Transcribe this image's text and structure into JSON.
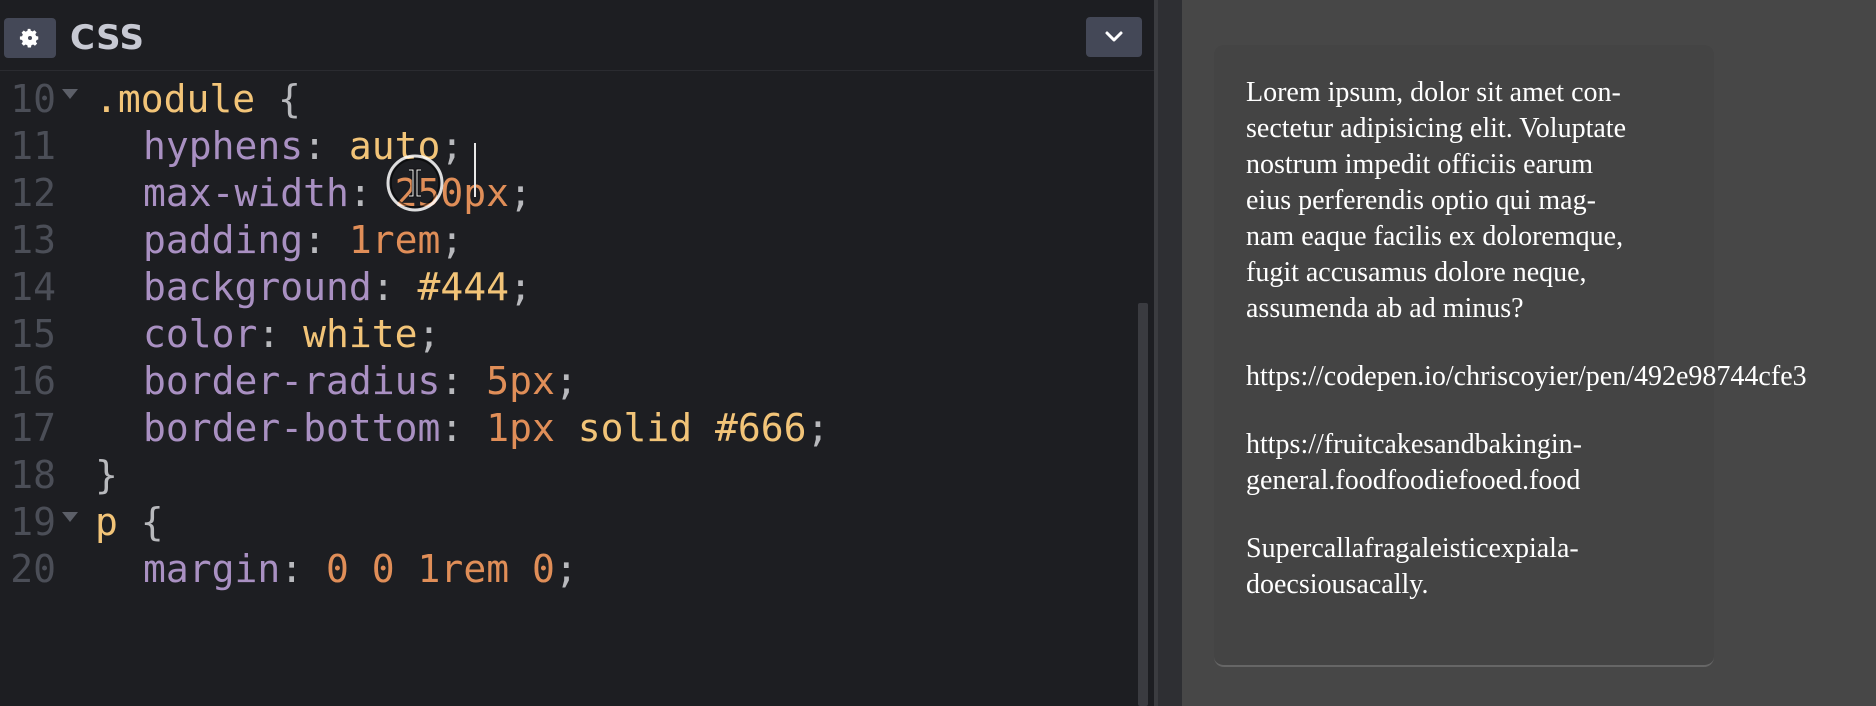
{
  "editor": {
    "title": "CSS",
    "settings_icon": "gear-icon",
    "collapse_icon": "chevron-down-icon",
    "lines": [
      {
        "number": "10",
        "fold": true,
        "tokens": [
          {
            "t": ".module",
            "c": "selector"
          },
          {
            "t": " ",
            "c": "plain"
          },
          {
            "t": "{",
            "c": "brace"
          }
        ]
      },
      {
        "number": "11",
        "fold": false,
        "indent": true,
        "tokens": [
          {
            "t": "hyphens",
            "c": "prop"
          },
          {
            "t": ": ",
            "c": "punc"
          },
          {
            "t": "auto",
            "c": "val"
          },
          {
            "t": ";",
            "c": "punc"
          }
        ]
      },
      {
        "number": "12",
        "fold": false,
        "indent": true,
        "tokens": [
          {
            "t": "max-width",
            "c": "prop"
          },
          {
            "t": ": ",
            "c": "punc"
          },
          {
            "t": "250px",
            "c": "num"
          },
          {
            "t": ";",
            "c": "punc"
          }
        ]
      },
      {
        "number": "13",
        "fold": false,
        "indent": true,
        "tokens": [
          {
            "t": "padding",
            "c": "prop"
          },
          {
            "t": ": ",
            "c": "punc"
          },
          {
            "t": "1rem",
            "c": "num"
          },
          {
            "t": ";",
            "c": "punc"
          }
        ]
      },
      {
        "number": "14",
        "fold": false,
        "indent": true,
        "tokens": [
          {
            "t": "background",
            "c": "prop"
          },
          {
            "t": ": ",
            "c": "punc"
          },
          {
            "t": "#444",
            "c": "val"
          },
          {
            "t": ";",
            "c": "punc"
          }
        ]
      },
      {
        "number": "15",
        "fold": false,
        "indent": true,
        "tokens": [
          {
            "t": "color",
            "c": "prop"
          },
          {
            "t": ": ",
            "c": "punc"
          },
          {
            "t": "white",
            "c": "val"
          },
          {
            "t": ";",
            "c": "punc"
          }
        ]
      },
      {
        "number": "16",
        "fold": false,
        "indent": true,
        "tokens": [
          {
            "t": "border-radius",
            "c": "prop"
          },
          {
            "t": ": ",
            "c": "punc"
          },
          {
            "t": "5px",
            "c": "num"
          },
          {
            "t": ";",
            "c": "punc"
          }
        ]
      },
      {
        "number": "17",
        "fold": false,
        "indent": true,
        "tokens": [
          {
            "t": "border-bottom",
            "c": "prop"
          },
          {
            "t": ": ",
            "c": "punc"
          },
          {
            "t": "1px",
            "c": "num"
          },
          {
            "t": " ",
            "c": "plain"
          },
          {
            "t": "solid",
            "c": "val"
          },
          {
            "t": " ",
            "c": "plain"
          },
          {
            "t": "#666",
            "c": "val"
          },
          {
            "t": ";",
            "c": "punc"
          }
        ]
      },
      {
        "number": "18",
        "fold": false,
        "tokens": [
          {
            "t": "}",
            "c": "brace"
          }
        ]
      },
      {
        "number": "19",
        "fold": true,
        "tokens": [
          {
            "t": "p",
            "c": "selector"
          },
          {
            "t": " ",
            "c": "plain"
          },
          {
            "t": "{",
            "c": "brace"
          }
        ]
      },
      {
        "number": "20",
        "fold": false,
        "indent": true,
        "tokens": [
          {
            "t": "margin",
            "c": "prop"
          },
          {
            "t": ": ",
            "c": "punc"
          },
          {
            "t": "0 0 1rem 0",
            "c": "num"
          },
          {
            "t": ";",
            "c": "punc"
          }
        ]
      }
    ]
  },
  "preview": {
    "paragraphs": [
      "Lorem ipsum, dolor sit amet con-\nsectetur adipisicing elit. Voluptate\nnostrum impedit officiis earum\neius perferendis optio qui mag-\nnam eaque facilis ex doloremque,\nfugit accusamus dolore neque,\nassumenda ab ad minus?",
      "https://codepen.io/chriscoyier/pen/492e98744cfe3",
      "https://fruitcakesandbakingin-\ngeneral.foodfoodiefooed.food",
      "Supercallafragaleisticexpiala-\ndoecsiousacally."
    ]
  },
  "colors": {
    "editor_bg": "#1d1e22",
    "selector": "#f2c478",
    "property": "#a990c2",
    "number": "#e08e58",
    "preview_bg": "#474747",
    "card_bg": "#444444"
  }
}
